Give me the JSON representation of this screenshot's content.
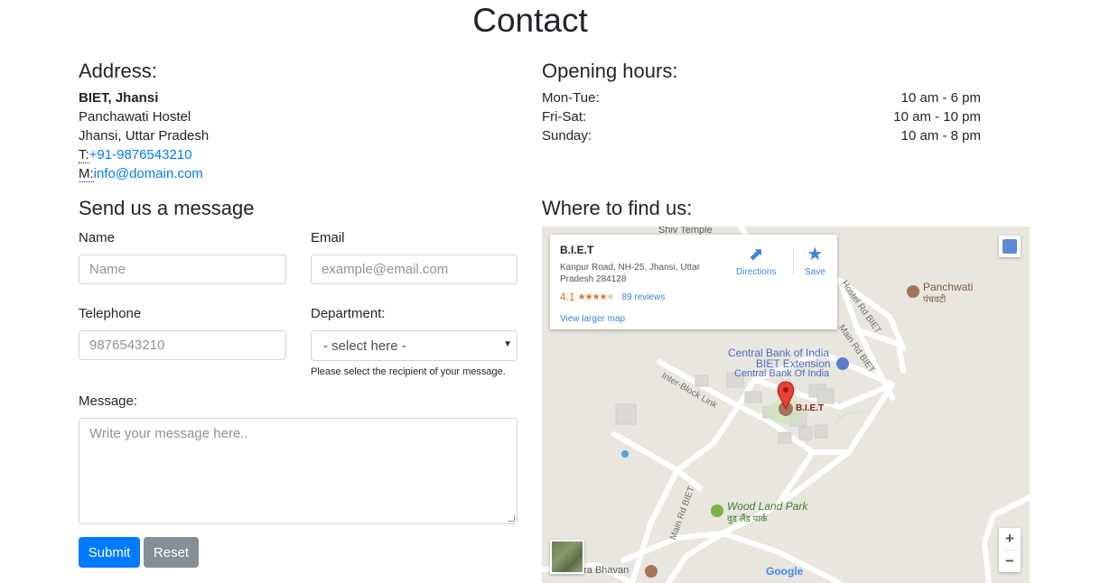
{
  "page_title": "Contact",
  "address": {
    "heading": "Address:",
    "name": "BIET, Jhansi",
    "line1": "Panchawati Hostel",
    "line2": "Jhansi, Uttar Pradesh",
    "phone_abbr": "T:",
    "phone": "+91-9876543210",
    "mail_abbr": "M:",
    "email": "info@domain.com"
  },
  "hours": {
    "heading": "Opening hours:",
    "rows": [
      {
        "day": "Mon-Tue:",
        "time": "10 am - 6 pm"
      },
      {
        "day": "Fri-Sat:",
        "time": "10 am - 10 pm"
      },
      {
        "day": "Sunday:",
        "time": "10 am - 8 pm"
      }
    ]
  },
  "form": {
    "heading": "Send us a message",
    "name_label": "Name",
    "name_placeholder": "Name",
    "email_label": "Email",
    "email_placeholder": "example@email.com",
    "phone_label": "Telephone",
    "phone_placeholder": "9876543210",
    "dept_label": "Department:",
    "dept_selected": "- select here -",
    "dept_help": "Please select the recipient of your message.",
    "message_label": "Message:",
    "message_placeholder": "Write your message here..",
    "submit_label": "Submit",
    "reset_label": "Reset"
  },
  "map": {
    "heading": "Where to find us:",
    "card": {
      "title": "B.I.E.T",
      "address": "Kanpur Road, NH-25, Jhansi, Uttar Pradesh 284128",
      "rating": "4.1",
      "stars": "★★★★",
      "star_empty": "★",
      "reviews": "89 reviews",
      "larger_map": "View larger map",
      "directions": "Directions",
      "save": "Save"
    },
    "labels": {
      "shiv_temple": "Shiv Temple",
      "hostel_rd": "Hostel Rd BIET",
      "panchwati": "Panchwati",
      "panchwati_hi": "पंचवटी",
      "main_rd_1": "Main Rd BIET",
      "cbi_1": "Central Bank of India",
      "cbi_2": "BIET Extension",
      "cbi_3": "Central Bank Of India",
      "inter_block": "Inter-Block Link",
      "biet": "B.I.E.T",
      "main_rd_2": "Main Rd BIET",
      "wood_land": "Wood Land Park",
      "wood_land_hi": "वुड लैंड पार्क",
      "bhavan": "ara Bhavan",
      "google": "Google"
    },
    "zoom_in": "+",
    "zoom_out": "−"
  },
  "colors": {
    "primary": "#007bff",
    "secondary": "#868e96",
    "map_bg": "#e8e6df",
    "pin": "#ea4335"
  }
}
